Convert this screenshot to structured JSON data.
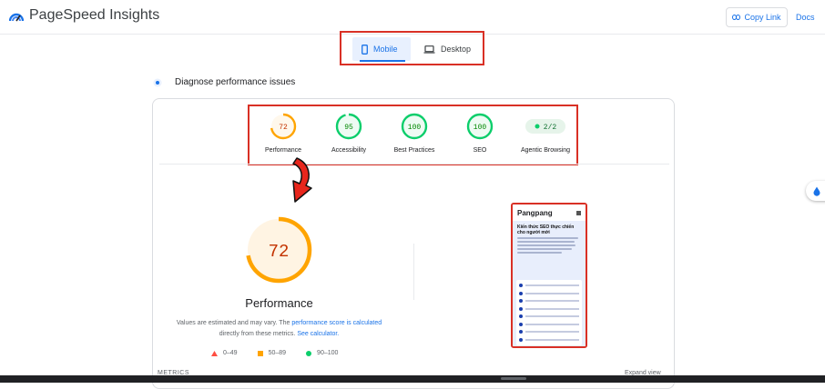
{
  "app": {
    "title": "PageSpeed Insights"
  },
  "header": {
    "copy_link": "Copy Link",
    "docs": "Docs"
  },
  "device_tabs": {
    "mobile": "Mobile",
    "desktop": "Desktop",
    "selected": "Mobile"
  },
  "section": {
    "title": "Diagnose performance issues"
  },
  "scores": [
    {
      "label": "Performance",
      "value": "72",
      "fraction": 0.72,
      "color": "#ffa400"
    },
    {
      "label": "Accessibility",
      "value": "95",
      "fraction": 0.95,
      "color": "#0cce6b"
    },
    {
      "label": "Best Practices",
      "value": "100",
      "fraction": 1.0,
      "color": "#0cce6b"
    },
    {
      "label": "SEO",
      "value": "100",
      "fraction": 1.0,
      "color": "#0cce6b"
    },
    {
      "label": "Agentic Browsing",
      "value": "2/2",
      "color": "#0cce6b"
    }
  ],
  "main_score": {
    "value": "72",
    "label": "Performance",
    "fraction": 0.72
  },
  "note": {
    "prefix": "Values are estimated and may vary. The ",
    "link1": "performance score is calculated",
    "middle": " directly from these metrics. ",
    "link2": "See calculator."
  },
  "legend": [
    {
      "range": "0–49",
      "color": "#ff4e42"
    },
    {
      "range": "50–89",
      "color": "#ffa400"
    },
    {
      "range": "90–100",
      "color": "#0cce6b"
    }
  ],
  "screenshot": {
    "brand": "Pangpang",
    "headline": "Kiến thức SEO thực chiến cho người mới"
  },
  "footer": {
    "metrics": "METRICS",
    "expand": "Expand view"
  },
  "colors": {
    "accent": "#1a73e8",
    "highlight_border": "#d93025",
    "average": "#ffa400",
    "pass": "#0cce6b",
    "fail": "#ff4e42"
  }
}
